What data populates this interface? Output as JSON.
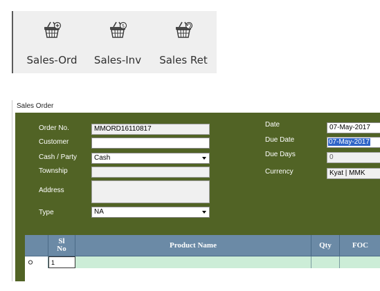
{
  "toolbar": {
    "buttons": [
      {
        "label": "Sales-Ord",
        "icon": "basket-plus-icon"
      },
      {
        "label": "Sales-Inv",
        "icon": "basket-dollar-icon"
      },
      {
        "label": "Sales Ret",
        "icon": "basket-return-icon"
      }
    ]
  },
  "window": {
    "title": "Sales Order"
  },
  "form": {
    "order_no_label": "Order No.",
    "order_no_value": "MMORD16110817",
    "customer_label": "Customer",
    "customer_value": "",
    "cash_party_label": "Cash / Party",
    "cash_party_value": "Cash",
    "township_label": "Township",
    "township_value": "",
    "address_label": "Address",
    "address_value": "",
    "type_label": "Type",
    "type_value": "NA",
    "date_label": "Date",
    "date_value": "07-May-2017",
    "due_date_label": "Due Date",
    "due_date_value": "07-May-2017",
    "due_days_label": "Due Days",
    "due_days_value": "0",
    "currency_label": "Currency",
    "currency_value": "Kyat | MMK"
  },
  "grid": {
    "columns": [
      "Sl No",
      "Product Name",
      "Qty",
      "FOC"
    ],
    "rows": [
      {
        "sl_no": "1",
        "product_name": "",
        "qty": "",
        "foc": ""
      }
    ]
  },
  "colors": {
    "panel": "#516325",
    "grid_header": "#6b8aa6",
    "grid_row": "#ccedd7",
    "selection": "#2f64c8"
  }
}
